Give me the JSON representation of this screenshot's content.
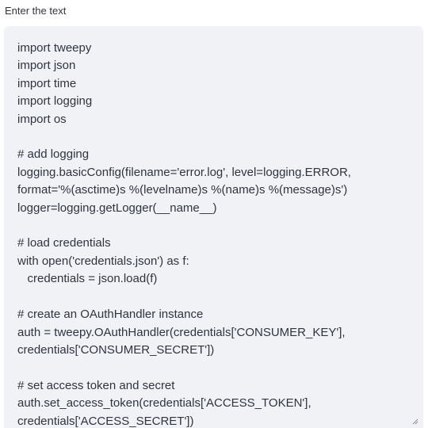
{
  "field": {
    "label": "Enter the text",
    "value": "import tweepy\nimport json\nimport time\nimport logging\nimport os\n\n# add logging\nlogging.basicConfig(filename='error.log', level=logging.ERROR,\nformat='%(asctime)s %(levelname)s %(name)s %(message)s')\nlogger=logging.getLogger(__name__)\n\n# load credentials\nwith open('credentials.json') as f:\n   credentials = json.load(f)\n\n# create an OAuthHandler instance\nauth = tweepy.OAuthHandler(credentials['CONSUMER_KEY'],\ncredentials['CONSUMER_SECRET'])\n\n# set access token and secret\nauth.set_access_token(credentials['ACCESS_TOKEN'],\ncredentials['ACCESS_SECRET'])"
  },
  "colors": {
    "text": "#31333f",
    "field_background": "#f0f2f6",
    "page_background": "#ffffff"
  },
  "icons": {
    "resize_handle": "resize-grip-icon"
  }
}
